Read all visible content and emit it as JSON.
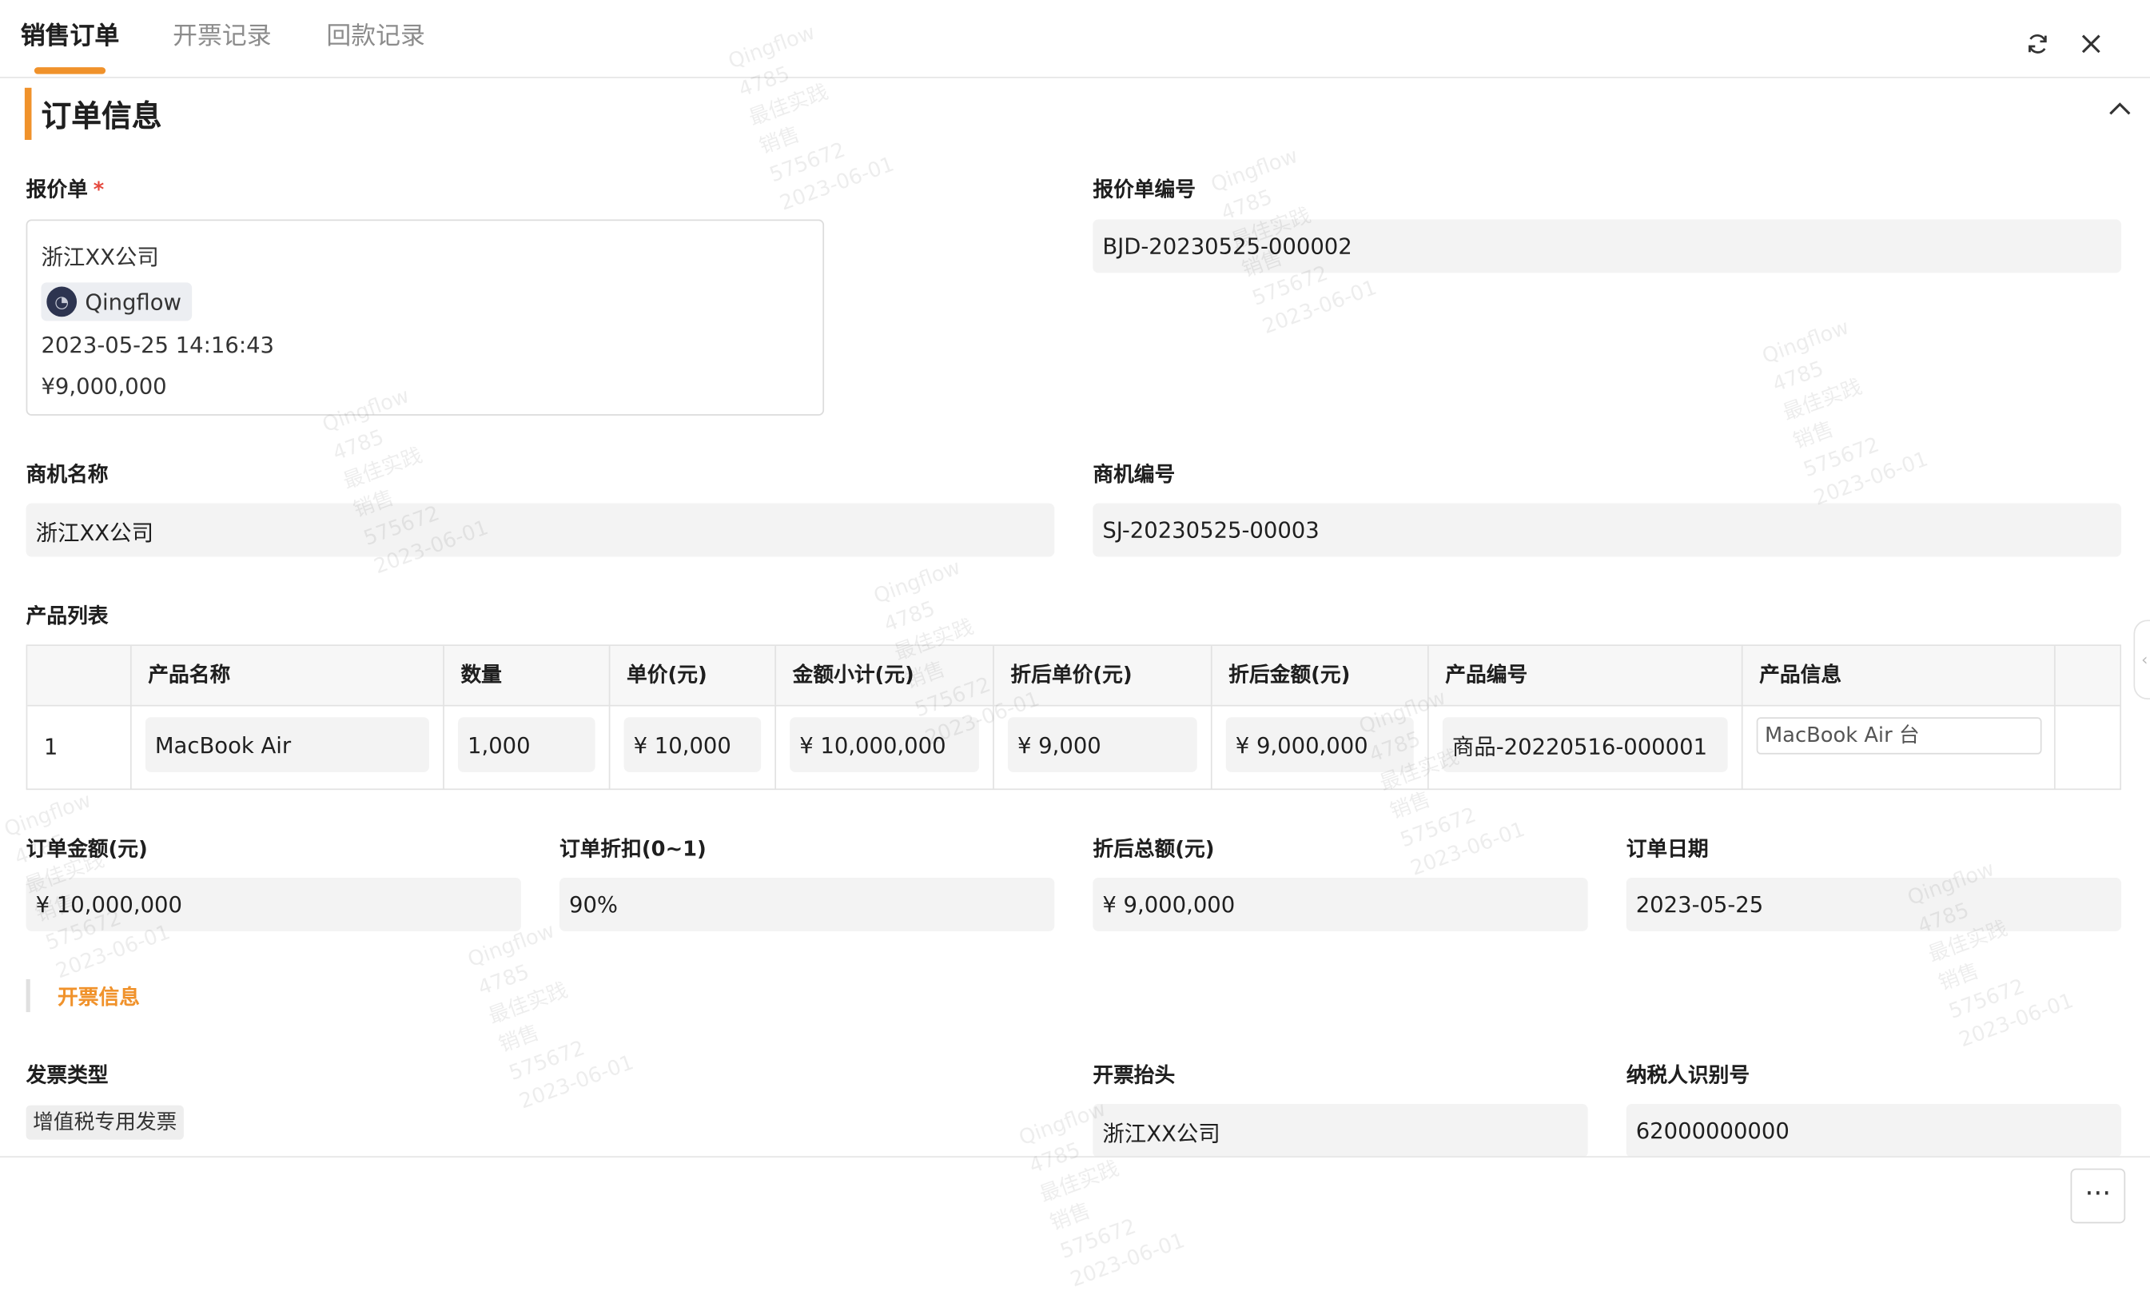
{
  "tabs": [
    {
      "label": "销售订单",
      "active": true
    },
    {
      "label": "开票记录",
      "active": false
    },
    {
      "label": "回款记录",
      "active": false
    }
  ],
  "header_icons": [
    "refresh-icon",
    "close-icon"
  ],
  "section": {
    "title": "订单信息"
  },
  "quote": {
    "label": "报价单",
    "required_mark": "*",
    "company": "浙江XX公司",
    "creator": "Qingflow",
    "datetime": "2023-05-25 14:16:43",
    "amount": "¥9,000,000"
  },
  "quote_no": {
    "label": "报价单编号",
    "value": "BJD-20230525-000002"
  },
  "opportunity_name": {
    "label": "商机名称",
    "value": "浙江XX公司"
  },
  "opportunity_no": {
    "label": "商机编号",
    "value": "SJ-20230525-00003"
  },
  "product_list": {
    "label": "产品列表",
    "columns": [
      "产品名称",
      "数量",
      "单价(元)",
      "金额小计(元)",
      "折后单价(元)",
      "折后金额(元)",
      "产品编号",
      "产品信息"
    ],
    "rows": [
      {
        "index": "1",
        "name": "MacBook Air",
        "qty": "1,000",
        "unit_price": "¥ 10,000",
        "subtotal": "¥ 10,000,000",
        "disc_price": "¥ 9,000",
        "disc_amount": "¥ 9,000,000",
        "code": "商品-20220516-000001",
        "info": "MacBook Air 台"
      }
    ]
  },
  "order_amount": {
    "label": "订单金额(元)",
    "value": "¥ 10,000,000"
  },
  "order_discount": {
    "label": "订单折扣(0~1)",
    "value": "90%"
  },
  "discounted_total": {
    "label": "折后总额(元)",
    "value": "¥ 9,000,000"
  },
  "order_date": {
    "label": "订单日期",
    "value": "2023-05-25"
  },
  "invoice_section": {
    "title": "开票信息"
  },
  "invoice_type": {
    "label": "发票类型",
    "value": "增值税专用发票"
  },
  "invoice_title": {
    "label": "开票抬头",
    "value": "浙江XX公司"
  },
  "taxpayer_id": {
    "label": "纳税人识别号",
    "value": "62000000000"
  },
  "watermark": {
    "lines": [
      "Qingflow",
      "4785",
      "最佳实践",
      "销售",
      "575672",
      "2023-06-01"
    ]
  },
  "footer": {
    "more_label": "···"
  },
  "colors": {
    "accent": "#f0922b",
    "field_bg": "#f3f3f3",
    "required": "#e5483d"
  }
}
